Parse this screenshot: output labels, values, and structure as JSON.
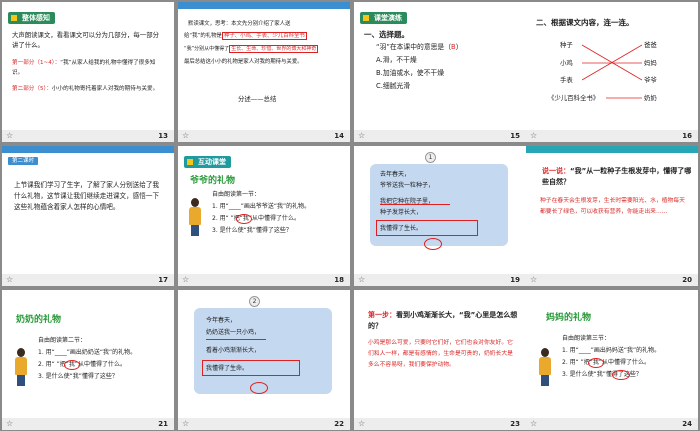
{
  "slides": [
    {
      "number": "13",
      "tag": "整体感知",
      "intro": "大声朗读课文，看看课文可以分为几部分，每一部分讲了什么。",
      "part1_label": "第一部分（1~4）：",
      "part1_text": "“我”从家人给我的礼物中懂得了很多知识。",
      "part2_label": "第二部分（5）：",
      "part2_text": "小小的礼物寄托着家人对我的期待与关爱。"
    },
    {
      "number": "14",
      "line1": "默读课文，思考：本文先分别介绍了家人送",
      "line2a": "给“我”的礼物是",
      "line2b": "种子、小鸡、手表、少儿百科全书",
      "line3a": "“我”分别从中懂得了",
      "line3b": "生长、生命、珍惜、世界的博大和神奇",
      "line4": "最后总结这小小的礼物是家人对我的期待与关爱。",
      "structure": "分述——总结"
    },
    {
      "number": "15",
      "tag": "课堂演练",
      "q_head": "一、选择题。",
      "q_text": "“羽”在本课中的意思是（",
      "q_answer": "B",
      "q_close": "）",
      "opt_a": "A.滑，不干燥",
      "opt_b": "B.加油或水，使不干燥",
      "opt_c": "C.细腻光滑"
    },
    {
      "number": "16",
      "heading": "二、根据课文内容，连一连。",
      "left": [
        "种子",
        "小鸡",
        "手表",
        "《少儿百科全书》"
      ],
      "right": [
        "爸爸",
        "妈妈",
        "爷爷",
        "奶奶"
      ]
    },
    {
      "number": "17",
      "pill": "第二课时",
      "para": "上节课我们学习了生字，了解了家人分别送给了我什么礼物，这节课让我们继续走进课文，感悟一下这些礼物蕴含着家人怎样的心情吧。"
    },
    {
      "number": "18",
      "tag": "互动课堂",
      "title": "爷爷的礼物",
      "read": "自由朗读第一节：",
      "i1": "1. 用“____”画出爷爷送“我”的礼物。",
      "i2": "2. 用“    ”把“我”从中懂得了什么。",
      "i3": "3. 是什么使“我”懂得了这些？"
    },
    {
      "number": "19",
      "badge": "1",
      "l1": "去年春天，",
      "l2": "爷爷送我一粒种子，",
      "l3": "我把它种在院子里，",
      "l4": "种子发芽长大，",
      "l5": "我懂得了生长。"
    },
    {
      "number": "20",
      "q_head": "说一说：",
      "q_text": "“我”从一粒种子生根发芽中，懂得了哪些自然？",
      "answer": "种子在春天会生根发芽，生长时需要阳光、水，植物每天都要长了绿色，可以收获有营养，你能走出来……"
    },
    {
      "number": "21",
      "title": "奶奶的礼物",
      "read": "自由朗读第二节：",
      "i1": "1. 用“____”画出奶奶送“我”的礼物。",
      "i2": "2. 用“    ”把“我”从中懂得了什么。",
      "i3": "3. 是什么使“我”懂得了这些？"
    },
    {
      "number": "22",
      "badge": "2",
      "l1": "今年春天，",
      "l2": "奶奶送我一只小鸡，",
      "l3": "看着小鸡渐渐长大，",
      "l4": "我懂得了生命。"
    },
    {
      "number": "23",
      "q_head": "第一步：",
      "q_text": "看到小鸡渐渐长大，“我”心里是怎么想的？",
      "answer": "小鸡是那么可爱，只要时它们好，它们也会对你友好。它们和人一样，都是有感情的，生命是可贵的，奶奶长大是多么不容易呀，我们要保护动物。"
    },
    {
      "number": "24",
      "title": "妈妈的礼物",
      "read": "自由朗读第三节：",
      "i1": "1. 用“____”画出妈妈送“我”的礼物。",
      "i2": "2. 用“    ”把“我”从中懂得了什么。",
      "i3": "3. 是什么使“我”懂得了这些？"
    }
  ],
  "colors": {
    "accent_blue": "#3b8fd0",
    "mark_red": "#e02020",
    "card_blue": "#c4d8f0"
  }
}
